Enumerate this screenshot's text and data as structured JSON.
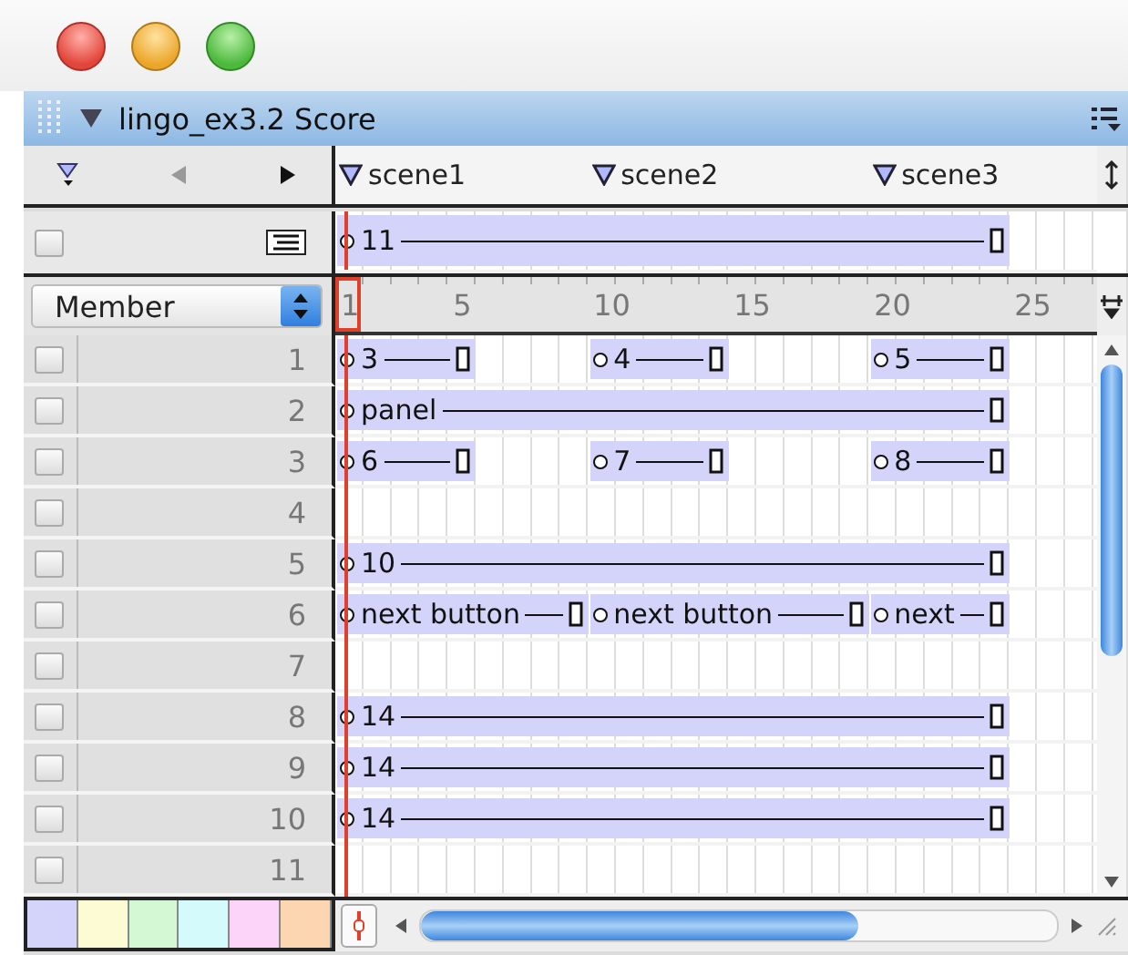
{
  "window": {
    "title": "lingo_ex3.2 Score"
  },
  "markers": [
    {
      "label": "scene1"
    },
    {
      "label": "scene2"
    },
    {
      "label": "scene3"
    }
  ],
  "script_channel": {
    "sprites": [
      {
        "label": "11",
        "kind": "span"
      }
    ]
  },
  "channel_menu": {
    "value": "Member"
  },
  "ruler": {
    "ticks": [
      "1",
      "5",
      "10",
      "15",
      "20",
      "25"
    ]
  },
  "channels": [
    {
      "number": "1",
      "sprites": [
        {
          "label": "3",
          "kind": "short"
        },
        {
          "label": "4",
          "kind": "short"
        },
        {
          "label": "5",
          "kind": "short"
        }
      ]
    },
    {
      "number": "2",
      "sprites": [
        {
          "label": "panel",
          "kind": "span"
        }
      ]
    },
    {
      "number": "3",
      "sprites": [
        {
          "label": "6",
          "kind": "short"
        },
        {
          "label": "7",
          "kind": "short"
        },
        {
          "label": "8",
          "kind": "short"
        }
      ]
    },
    {
      "number": "4"
    },
    {
      "number": "5",
      "sprites": [
        {
          "label": "10",
          "kind": "span"
        }
      ]
    },
    {
      "number": "6",
      "sprites": [
        {
          "label": "next button",
          "kind": "scene"
        },
        {
          "label": "next button",
          "kind": "scene"
        },
        {
          "label": "next",
          "kind": "scene"
        }
      ]
    },
    {
      "number": "7"
    },
    {
      "number": "8",
      "sprites": [
        {
          "label": "14",
          "kind": "span"
        }
      ]
    },
    {
      "number": "9",
      "sprites": [
        {
          "label": "14",
          "kind": "span"
        }
      ]
    },
    {
      "number": "10",
      "sprites": [
        {
          "label": "14",
          "kind": "span"
        }
      ]
    },
    {
      "number": "11"
    }
  ],
  "swatches": [
    {
      "color": "#d4d4fa"
    },
    {
      "color": "#fdfbd4"
    },
    {
      "color": "#d4f8d4"
    },
    {
      "color": "#d4fafc"
    },
    {
      "color": "#fcd4fa"
    },
    {
      "color": "#fcd6b0"
    }
  ]
}
